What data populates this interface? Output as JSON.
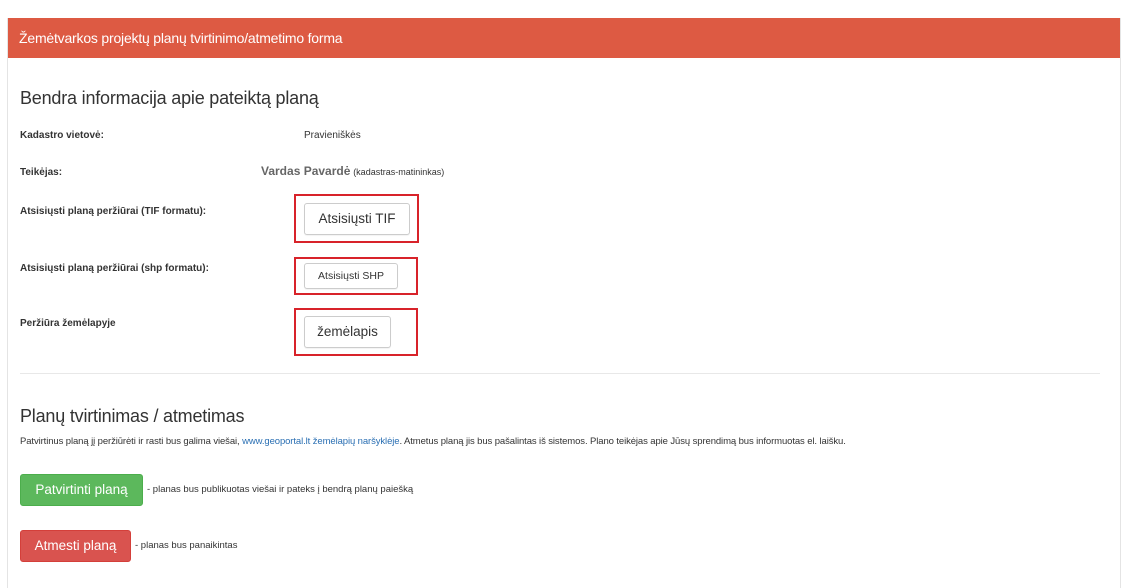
{
  "header": {
    "title": "Žemėtvarkos projektų planų tvirtinimo/atmetimo forma",
    "color": "#dd5a43"
  },
  "general": {
    "title": "Bendra informacija apie pateiktą planą",
    "cadastre_label": "Kadastro vietovė:",
    "cadastre_value": "Pravieniškės",
    "submitter_label": "Teikėjas:",
    "submitter_name": "Vardas Pavardė",
    "submitter_role": "(kadastras-matininkas)",
    "tif_label": "Atsisiųsti planą peržiūrai (TIF formatu):",
    "tif_button": "Atsisiųsti TIF",
    "shp_label": "Atsisiųsti planą peržiūrai (shp formatu):",
    "shp_button": "Atsisiųsti SHP",
    "map_label": "Peržiūra žemėlapyje",
    "map_button": "žemėlapis",
    "highlight_color": "#d8232a"
  },
  "approval": {
    "title": "Planų tvirtinimas / atmetimas",
    "info_before": "Patvirtinus planą jį peržiūrėti ir rasti bus galima viešai, ",
    "info_link": "www.geoportal.lt žemėlapių naršyklėje",
    "info_after": ". Atmetus planą jis bus pašalintas iš sistemos. Plano teikėjas apie Jūsų sprendimą bus informuotas el. laišku.",
    "approve_button": "Patvirtinti planą",
    "approve_note": "- planas bus publikuotas viešai ir pateks į bendrą planų paiešką",
    "reject_button": "Atmesti planą",
    "reject_note": "- planas bus panaikintas",
    "approve_color": "#5cb85c",
    "reject_color": "#d9534f"
  }
}
